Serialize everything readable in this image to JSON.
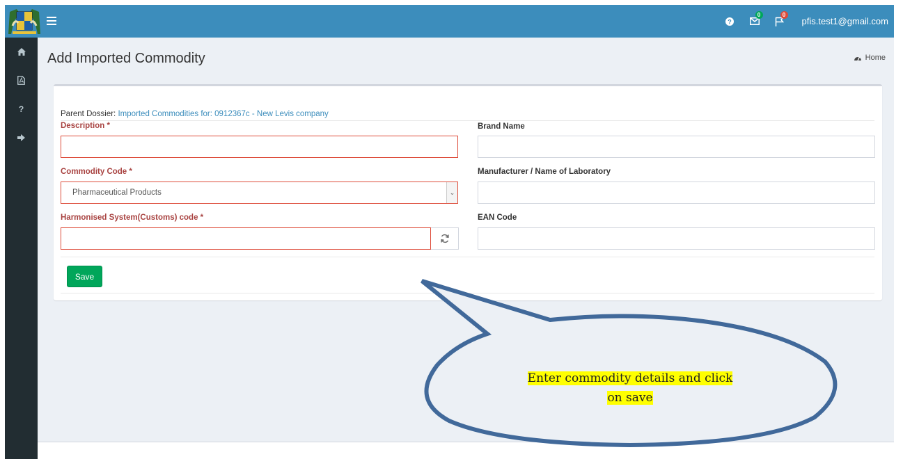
{
  "topbar": {
    "help_icon": "question-circle-icon",
    "messages_icon": "envelope-icon",
    "messages_badge": "0",
    "flags_icon": "flag-icon",
    "flags_badge": "0",
    "user_email": "pfis.test1@gmail.com"
  },
  "sidebar": {
    "items": [
      {
        "icon": "home-icon"
      },
      {
        "icon": "file-pdf-icon"
      },
      {
        "icon": "question-icon",
        "glyph": "?"
      },
      {
        "icon": "sign-out-icon"
      }
    ]
  },
  "page": {
    "title": "Add Imported Commodity",
    "home_label": "Home"
  },
  "form": {
    "parent_dossier_label": "Parent Dossier:",
    "parent_dossier_link": "Imported Commodities for: 0912367c - New Levis company",
    "description_label": "Description *",
    "description_value": "",
    "commodity_code_label": "Commodity Code *",
    "commodity_code_value": "Pharmaceutical Products",
    "hs_code_label": "Harmonised System(Customs) code *",
    "hs_code_value": "",
    "brand_name_label": "Brand Name",
    "brand_name_value": "",
    "manufacturer_label": "Manufacturer / Name of Laboratory",
    "manufacturer_value": "",
    "ean_label": "EAN Code",
    "ean_value": "",
    "save_label": "Save"
  },
  "callout": {
    "line1": "Enter commodity details and click",
    "line2": "on save",
    "highlight_color": "#ffff00",
    "stroke_color": "#41699a"
  },
  "colors": {
    "header": "#3c8dbc",
    "sidebar": "#222d32",
    "content_bg": "#ecf0f5",
    "required_label": "#a94442",
    "error_border": "#dd4b39",
    "save_button": "#00a65a"
  }
}
